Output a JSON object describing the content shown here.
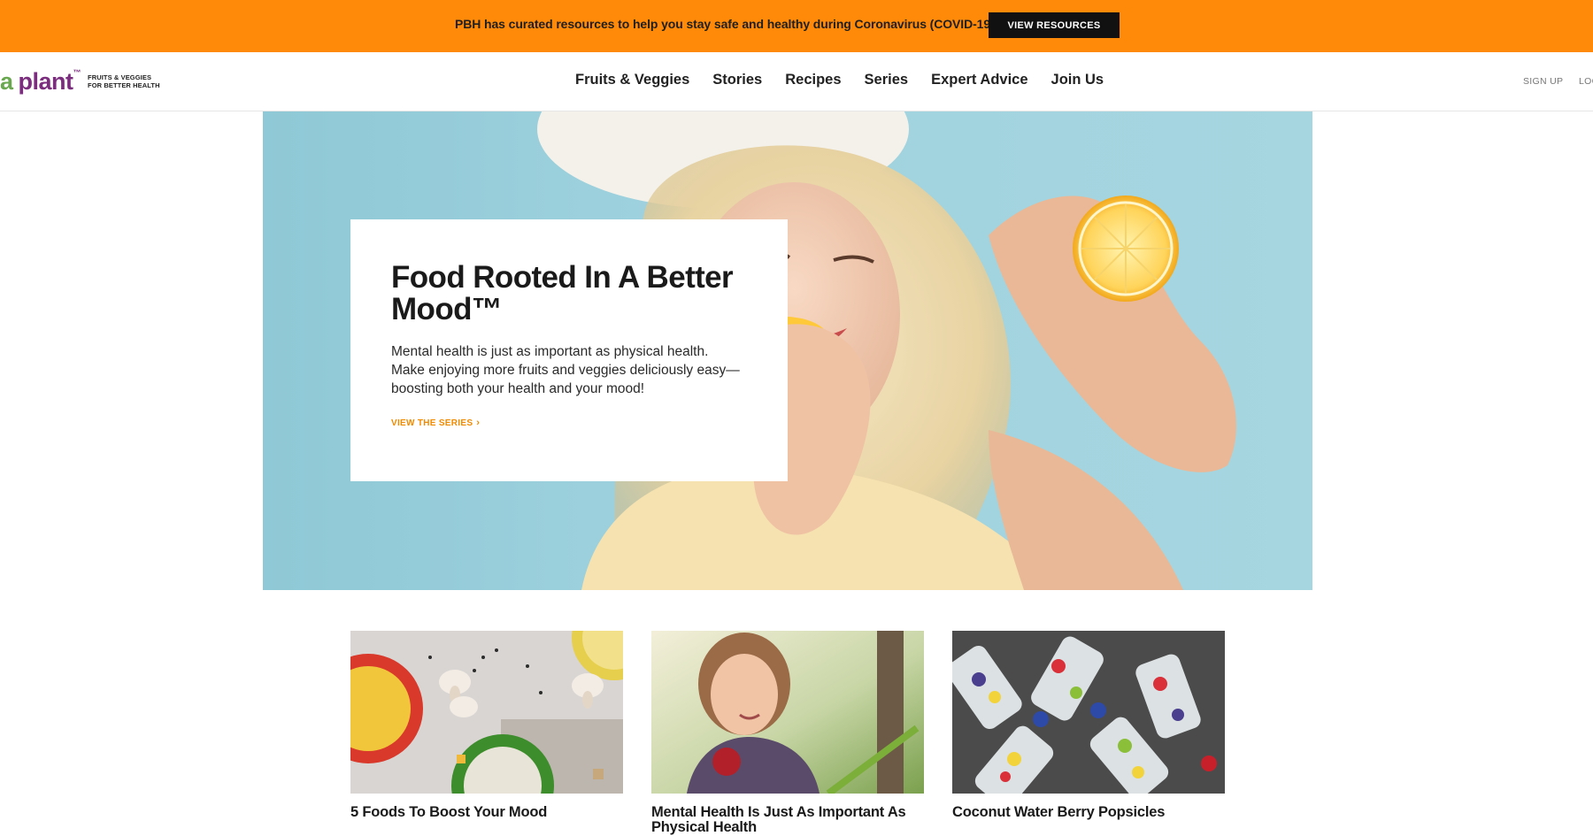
{
  "banner": {
    "text": "PBH has curated resources to help you stay safe and healthy during Coronavirus (COVID-19).",
    "button_label": "VIEW RESOURCES",
    "color": "#ff8a0a"
  },
  "header": {
    "logo": {
      "letter": "a",
      "word": "plant",
      "trademark": "™",
      "tagline_line1": "FRUITS & VEGGIES",
      "tagline_line2": "FOR BETTER HEALTH"
    },
    "nav": [
      {
        "label": "Fruits & Veggies"
      },
      {
        "label": "Stories"
      },
      {
        "label": "Recipes"
      },
      {
        "label": "Series"
      },
      {
        "label": "Expert Advice"
      },
      {
        "label": "Join Us"
      }
    ],
    "utility": {
      "signup": "SIGN UP",
      "login": "LOG"
    }
  },
  "hero": {
    "title": "Food Rooted In A Better Mood™",
    "description": "Mental health is just as important as physical health. Make enjoying more fruits and veggies deliciously easy—boosting both your health and your mood!",
    "link_label": "VIEW THE SERIES",
    "link_icon": "chevron-right-icon",
    "accent_color": "#f08a00"
  },
  "cards": [
    {
      "title": "5 Foods To Boost Your Mood",
      "image": "bowls-and-mushrooms-photo"
    },
    {
      "title": "Mental Health Is Just As Important As Physical Health",
      "image": "woman-with-apple-photo"
    },
    {
      "title": "Coconut Water Berry Popsicles",
      "image": "berry-popsicles-photo"
    }
  ],
  "colors": {
    "brand_purple": "#7b2d7e",
    "brand_green": "#6aa84f",
    "banner_orange": "#ff8a0a",
    "hero_sky": "#a6d6e0"
  }
}
